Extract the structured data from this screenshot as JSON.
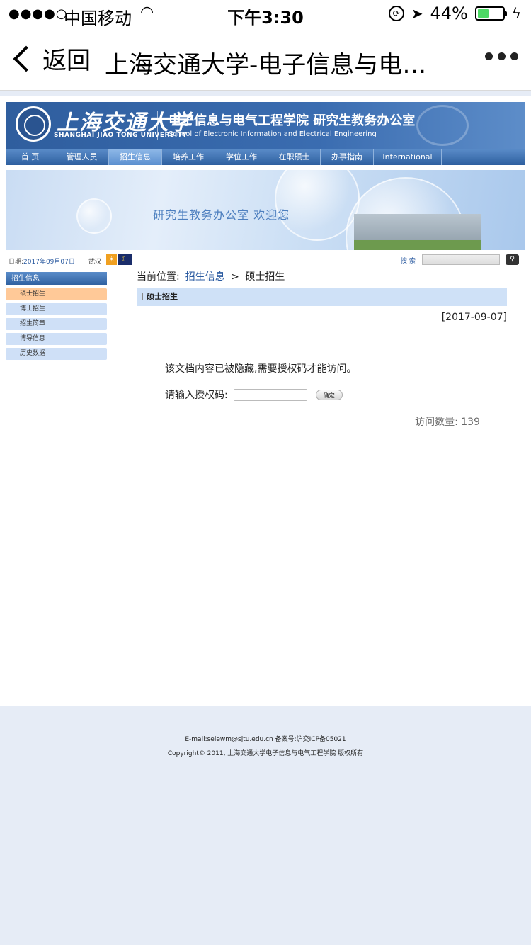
{
  "status_bar": {
    "signal": "●●●●○",
    "carrier": "中国移动",
    "time": "下午3:30",
    "battery": "44%",
    "battery_level": 0.44
  },
  "nav": {
    "back_label": "返回",
    "title": "上海交通大学-电子信息与电…"
  },
  "site_header": {
    "logo_cn": "上海交通大学",
    "logo_en": "SHANGHAI JIAO TONG UNIVERSITY",
    "school_cn": "电子信息与电气工程学院 研究生教务办公室",
    "school_en": "School of Electronic Information and Electrical Engineering"
  },
  "menu": [
    {
      "label": "首 页",
      "w": 70
    },
    {
      "label": "管理人员",
      "w": 76
    },
    {
      "label": "招生信息",
      "w": 75
    },
    {
      "label": "培养工作",
      "w": 75
    },
    {
      "label": "学位工作",
      "w": 75
    },
    {
      "label": "在职硕士",
      "w": 74
    },
    {
      "label": "办事指南",
      "w": 75
    },
    {
      "label": "International",
      "w": 96
    }
  ],
  "hero": {
    "welcome": "研究生教务办公室 欢迎您"
  },
  "info_bar": {
    "date_label": "日期:",
    "date_value": "2017年09月07日",
    "city": "武汉",
    "search_label": "搜 索"
  },
  "sidebar": {
    "heading": "招生信息",
    "items": [
      "硕士招生",
      "博士招生",
      "招生简章",
      "博导信息",
      "历史数据"
    ]
  },
  "content": {
    "crumb_label": "当前位置:",
    "crumb_link": "招生信息",
    "crumb_sep": ">",
    "crumb_current": "硕士招生",
    "section_title": "硕士招生",
    "article_date": "[2017-09-07]",
    "hidden_msg": "该文档内容已被隐藏,需要授权码才能访问。",
    "pw_label": "请输入授权码:",
    "pw_button": "确定",
    "visits_label": "访问数量:",
    "visits_count": "139"
  },
  "footer": {
    "line1": "E-mail:seiewm@sjtu.edu.cn 备案号:沪交ICP备05021",
    "line2": "Copyright© 2011, 上海交通大学电子信息与电气工程学院 版权所有"
  }
}
